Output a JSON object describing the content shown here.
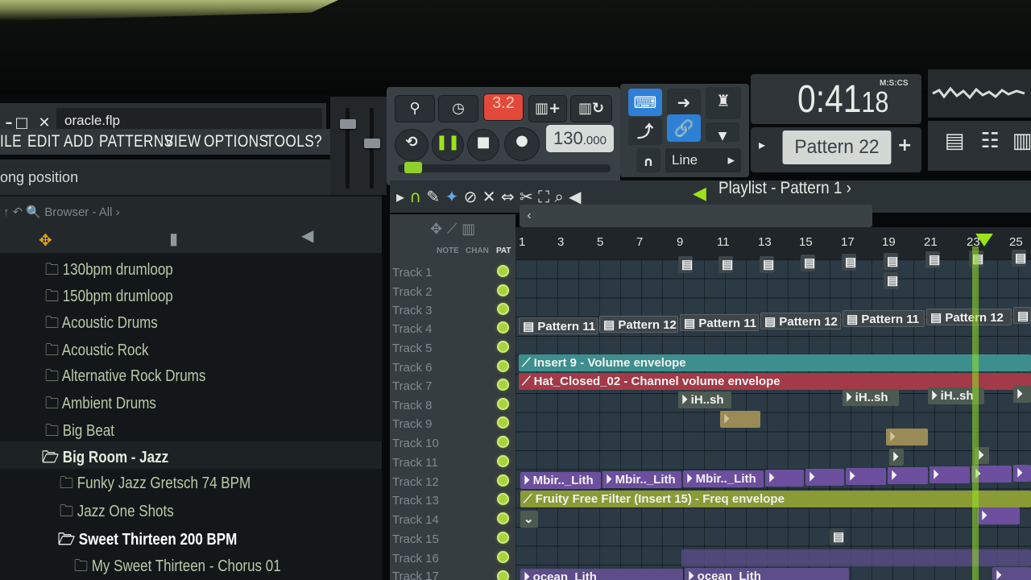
{
  "window": {
    "file_name": "oracle.flp",
    "controls": [
      "–",
      "□",
      "✕"
    ]
  },
  "menu": [
    "ILE",
    "EDIT",
    "ADD",
    "PATTERNS",
    "VIEW",
    "OPTIONS",
    "TOOLS",
    "?"
  ],
  "hint_bar": "ong position",
  "transport": {
    "mode_label": "3.2",
    "tempo_main": "130",
    "tempo_fraction": ".000"
  },
  "toolbar": {
    "snap_value": "Line"
  },
  "clock": {
    "time_main": "0:41",
    "time_sub": "18",
    "format": "M:S:CS"
  },
  "pattern_selector": "Pattern 22",
  "browser": {
    "label": "Browser - All",
    "items": [
      {
        "label": "130bpm drumloop"
      },
      {
        "label": "150bpm drumloop"
      },
      {
        "label": "Acoustic Drums"
      },
      {
        "label": "Acoustic Rock"
      },
      {
        "label": "Alternative Rock Drums"
      },
      {
        "label": "Ambient Drums"
      },
      {
        "label": "Big Beat"
      },
      {
        "label": "Big Room - Jazz"
      },
      {
        "label": "Funky Jazz Gretsch 74 BPM"
      },
      {
        "label": "Jazz One Shots"
      },
      {
        "label": "Sweet Thirteen 200 BPM"
      },
      {
        "label": "My Sweet Thirteen - Chorus 01"
      }
    ]
  },
  "playlist": {
    "title": "Playlist - Pattern 1",
    "header_labels": [
      "NOTE",
      "CHAN",
      "PAT"
    ],
    "ruler": [
      "1",
      "3",
      "5",
      "7",
      "9",
      "11",
      "13",
      "15",
      "17",
      "19",
      "21",
      "23",
      "25"
    ],
    "tracks": [
      "Track 1",
      "Track 2",
      "Track 3",
      "Track 4",
      "Track 5",
      "Track 6",
      "Track 7",
      "Track 8",
      "Track 9",
      "Track 10",
      "Track 11",
      "Track 12",
      "Track 13",
      "Track 14",
      "Track 15",
      "Track 16",
      "Track 17"
    ],
    "clips": {
      "pattern_11": "Pattern 11",
      "pattern_12": "Pattern 12",
      "insert9": "Insert 9 - Volume envelope",
      "hat_closed": "Hat_Closed_02 - Channel volume envelope",
      "ih_sh": "iH..sh",
      "mbir": "Mbir.._Lith",
      "fruity_filter": "Fruity Free Filter (Insert 15) - Freq envelope",
      "ocean": "ocean_Lith"
    }
  },
  "colors": {
    "led_green": "#a8d43a",
    "playhead": "#9be21b",
    "accent_blue": "#2e7fd6",
    "record_red": "#e2493a"
  }
}
